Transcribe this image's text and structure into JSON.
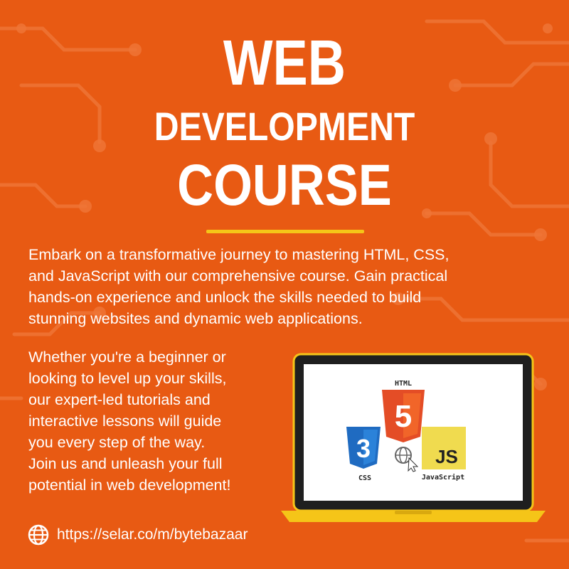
{
  "title": {
    "line1": "WEB",
    "line2": "DEVELOPMENT",
    "line3": "COURSE"
  },
  "intro_paragraph": [
    "Embark on a transformative journey to mastering HTML, CSS,",
    "and JavaScript with our comprehensive course. Gain practical",
    "hands-on experience and unlock the skills needed to build",
    "stunning websites and dynamic web applications."
  ],
  "invite_paragraph": [
    "Whether you're a beginner or",
    "looking to level up your skills,",
    "our expert-led tutorials and",
    "interactive lessons will guide",
    "you every step of the way.",
    "Join us and unleash your full",
    "potential in web development!"
  ],
  "illustration": {
    "html_label": "HTML",
    "html_badge": "5",
    "css_label": "CSS",
    "css_badge": "3",
    "js_badge": "JS",
    "js_label": "JavaScript"
  },
  "link": {
    "url_text": "https://selar.co/m/bytebazaar",
    "icon": "globe-icon"
  },
  "colors": {
    "background": "#e85a13",
    "accent": "#f5c518",
    "html_orange": "#e44d26",
    "css_blue": "#1f6bc1",
    "js_yellow": "#f0db4f"
  }
}
